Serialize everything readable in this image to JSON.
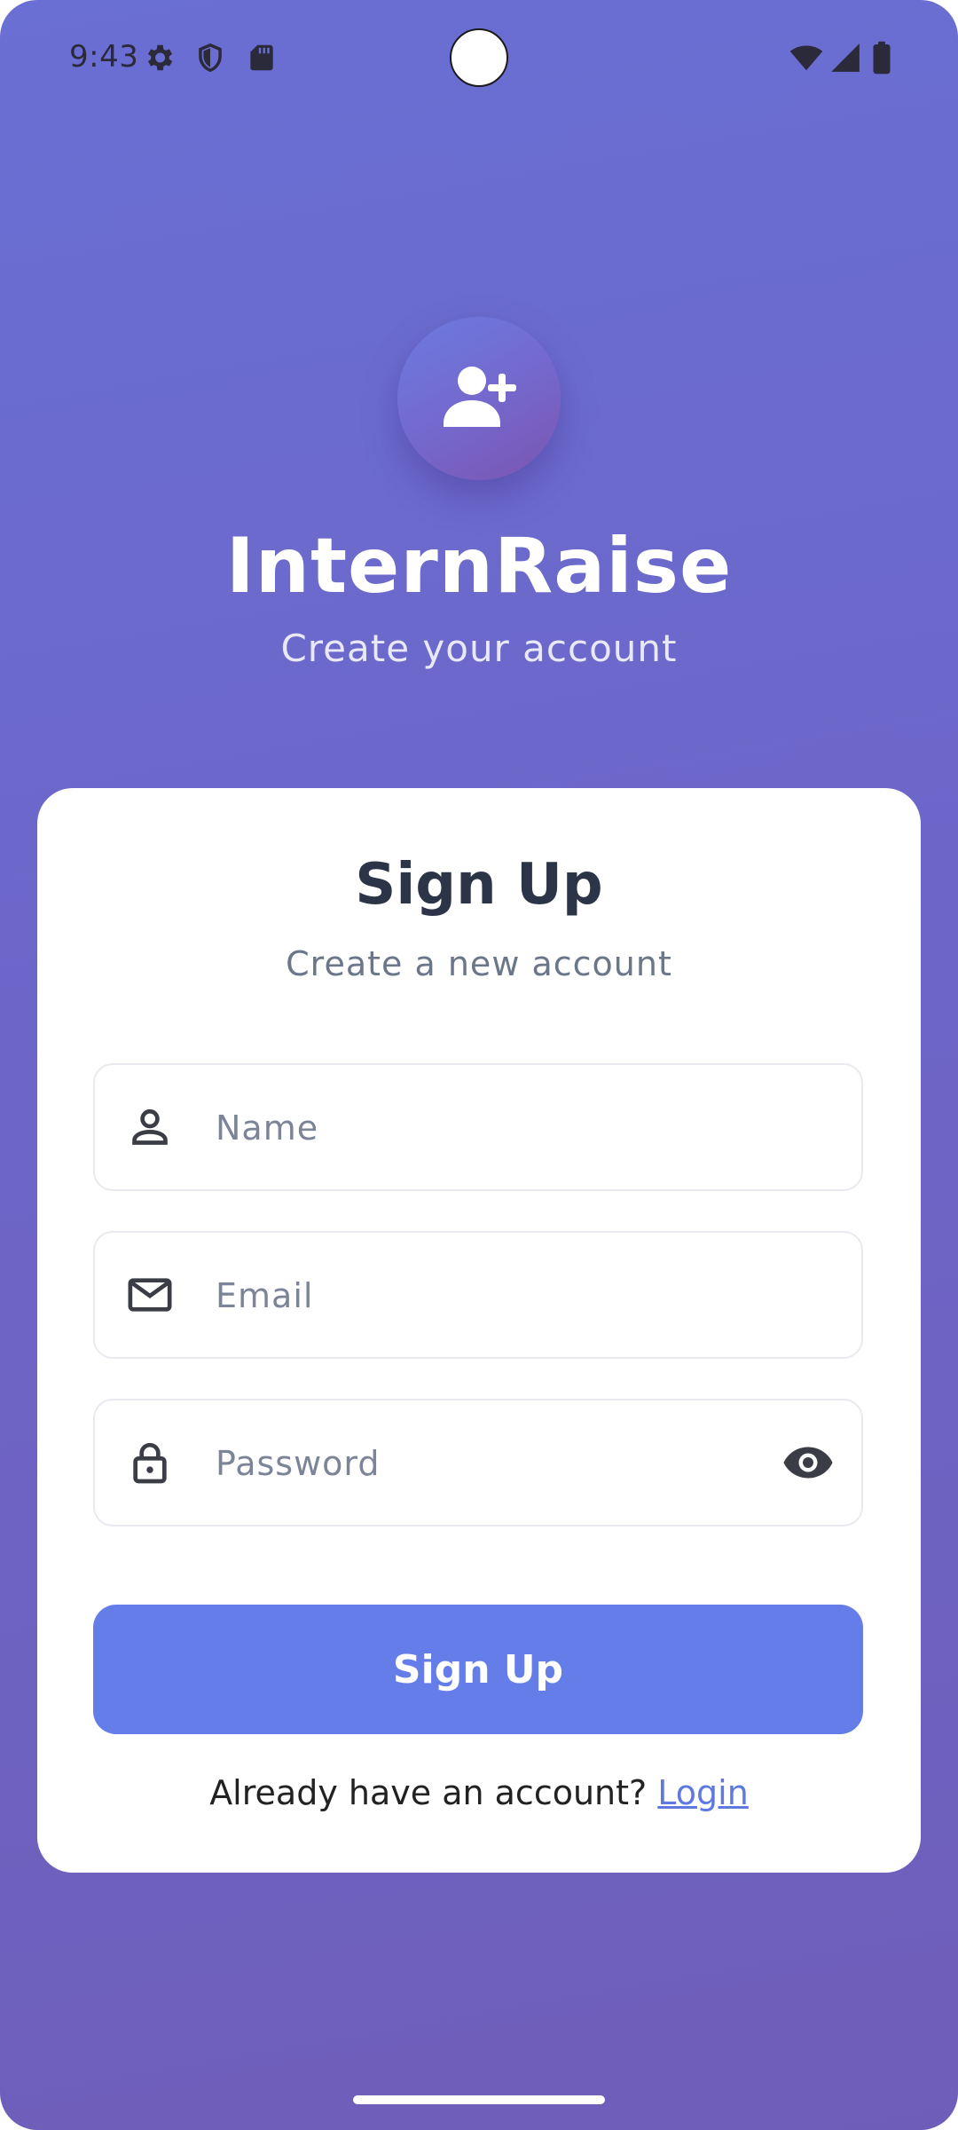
{
  "status_bar": {
    "time": "9:43",
    "left_icons": [
      "gear-icon",
      "shield-icon",
      "sd-card-icon"
    ],
    "right_icons": [
      "wifi-icon",
      "signal-icon",
      "battery-icon"
    ]
  },
  "header": {
    "icon": "person-add-icon",
    "app_name": "InternRaise",
    "tagline": "Create your account"
  },
  "card": {
    "title": "Sign Up",
    "subtitle": "Create a new account",
    "fields": {
      "name": {
        "placeholder": "Name",
        "value": "",
        "icon": "person-icon"
      },
      "email": {
        "placeholder": "Email",
        "value": "",
        "icon": "mail-icon"
      },
      "password": {
        "placeholder": "Password",
        "value": "",
        "icon": "lock-icon",
        "toggle_icon": "eye-icon"
      }
    },
    "submit_label": "Sign Up",
    "login_prompt": "Already have an account?",
    "login_link": "Login"
  },
  "colors": {
    "background_top": "#6a6fd3",
    "background_bottom": "#6f5eb9",
    "primary_button": "#657de8",
    "link": "#5f79e0",
    "title_text": "#2c3447"
  }
}
